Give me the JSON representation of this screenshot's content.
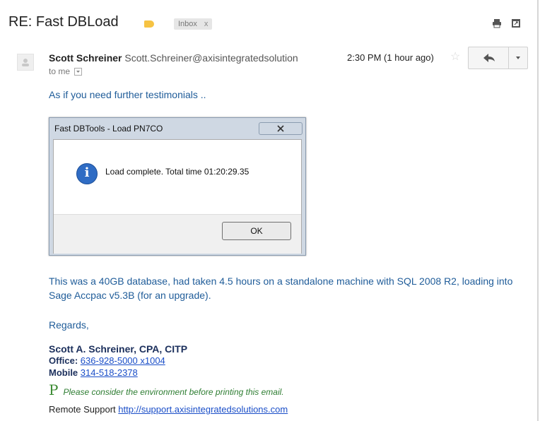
{
  "email": {
    "subject": "RE: Fast DBLoad",
    "label_chip": {
      "label": "Inbox",
      "close": "x"
    },
    "sender_name": "Scott Schreiner",
    "sender_email": "Scott.Schreiner@axisintegratedsolution",
    "to_line": "to me",
    "time": "2:30 PM (1 hour ago)",
    "intro": "As if you need further testimonials ..",
    "dialog": {
      "title": "Fast DBTools - Load PN7CO",
      "close_glyph": "x",
      "message": "Load complete. Total time 01:20:29.35",
      "ok_label": "OK"
    },
    "details": "This was a 40GB database, had taken 4.5 hours on a standalone machine with SQL 2008 R2, loading into Sage Accpac v5.3B (for an upgrade).",
    "regards": "Regards,",
    "signature": {
      "name": "Scott A. Schreiner, CPA, CITP",
      "office_label": "Office:",
      "office_number": "636-928-5000 x1004",
      "mobile_label": "Mobile",
      "mobile_number": "314-518-2378",
      "env_glyph": "P",
      "env_note": "Please consider the environment before printing this email.",
      "remote_label": "Remote Support",
      "remote_url": "http://support.axisintegratedsolutions.com"
    }
  },
  "icons": {
    "print": "print-icon",
    "newwindow": "new-window-icon",
    "star": "star-icon",
    "reply": "reply-icon",
    "more": "chevron-down-icon",
    "info": "info-icon",
    "avatar": "person-icon"
  },
  "colors": {
    "body_text": "#1f5c99",
    "label_tag": "#f6c343",
    "link": "#1a4ec8",
    "signature": "#1b2f5c",
    "env_green": "#2e7d32"
  }
}
